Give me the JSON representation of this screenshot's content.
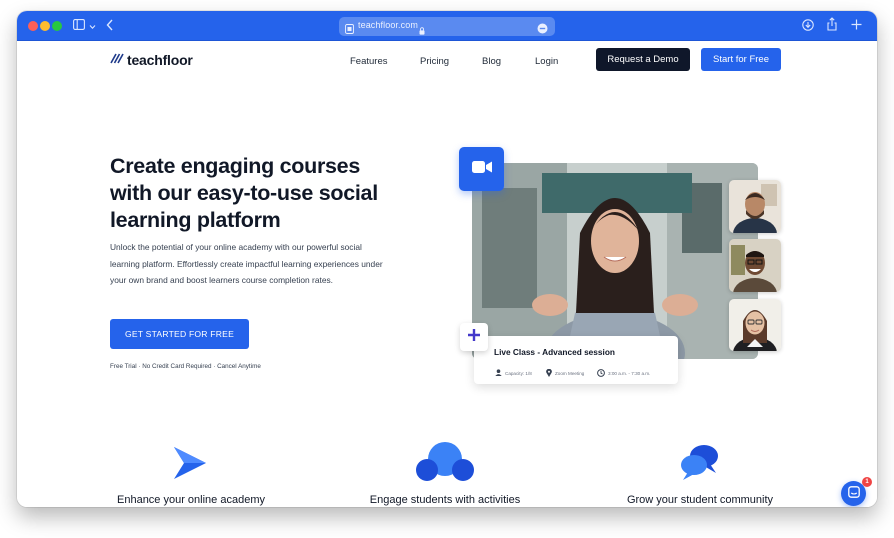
{
  "browser": {
    "url": "teachfloor.com",
    "colors": {
      "chrome": "#2563eb",
      "close": "#ff5f57",
      "minimize": "#febc2e",
      "maximize": "#28c840"
    },
    "icons": [
      "sidebar-icon",
      "chevron-down-icon",
      "back-icon",
      "site-icon",
      "lock-icon",
      "reader-icon",
      "download-icon",
      "share-icon",
      "new-tab-icon"
    ]
  },
  "header": {
    "logo": "teachfloor",
    "nav": [
      "Features",
      "Pricing",
      "Blog",
      "Login"
    ],
    "demo_button": "Request a Demo",
    "start_button": "Start for Free",
    "colors": {
      "primary": "#2563eb",
      "dark": "#0f172a"
    }
  },
  "hero": {
    "title": "Create engaging courses with our easy-to-use social learning platform",
    "description": "Unlock the potential of your online academy with our powerful social learning platform. Effortlessly create impactful learning experiences under your own brand and boost learners course completion rates.",
    "cta": "GET STARTED FOR FREE",
    "note": "Free Trial · No Credit Card Required · Cancel Anytime"
  },
  "live_card": {
    "title": "Live Class - Advanced session",
    "capacity": "Capacity: 1/8",
    "location": "Zoom Meeting",
    "time": "3:00 a.m. - 7:30 a.m."
  },
  "features": [
    {
      "label": "Enhance your online academy",
      "icon": "play-arrow-icon"
    },
    {
      "label": "Engage students with activities",
      "icon": "bubbles-icon"
    },
    {
      "label": "Grow your student community",
      "icon": "chat-bubbles-icon"
    }
  ],
  "chat_widget": {
    "badge": "1",
    "icon": "chat-widget-icon"
  }
}
